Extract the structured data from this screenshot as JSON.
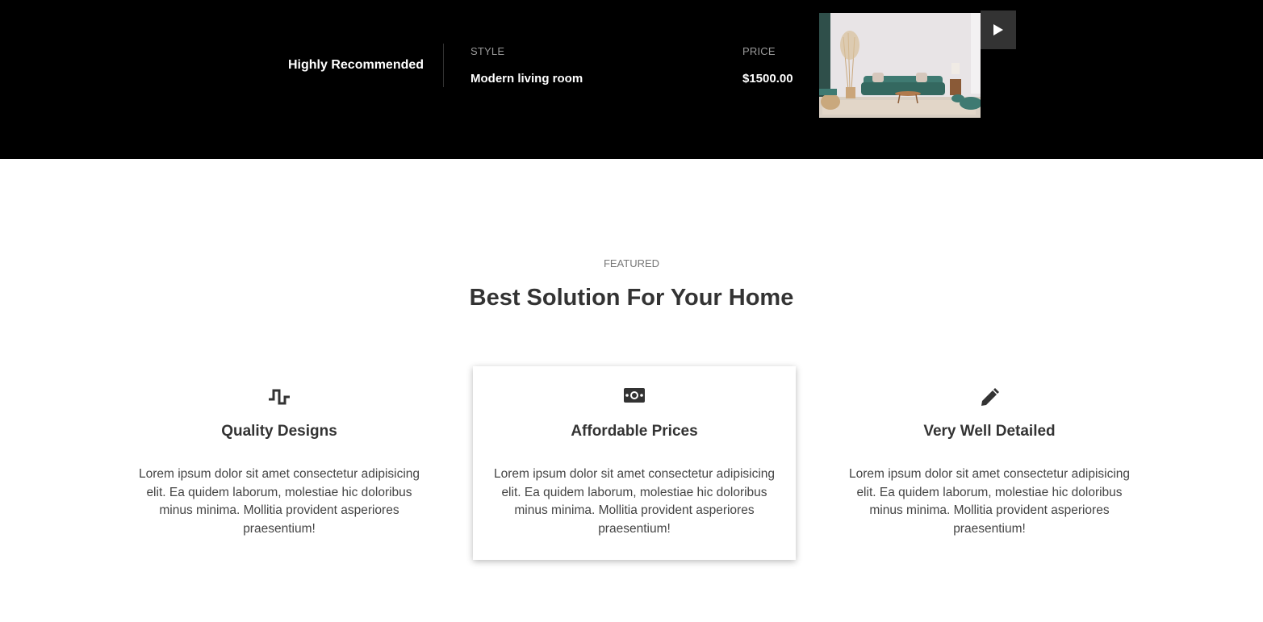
{
  "hero": {
    "recommendation": "Highly Recommended",
    "style_label": "STYLE",
    "style_value": "Modern living room",
    "price_label": "PRICE",
    "price_value": "$1500.00"
  },
  "section": {
    "eyebrow": "FEATURED",
    "title": "Best Solution For Your Home"
  },
  "features": [
    {
      "icon": "pulse-icon",
      "title": "Quality Designs",
      "text": "Lorem ipsum dolor sit amet consectetur adipisicing elit. Ea quidem laborum, molestiae hic doloribus minus minima. Mollitia provident asperiores praesentium!"
    },
    {
      "icon": "money-icon",
      "title": "Affordable Prices",
      "text": "Lorem ipsum dolor sit amet consectetur adipisicing elit. Ea quidem laborum, molestiae hic doloribus minus minima. Mollitia provident asperiores praesentium!"
    },
    {
      "icon": "pencil-icon",
      "title": "Very Well Detailed",
      "text": "Lorem ipsum dolor sit amet consectetur adipisicing elit. Ea quidem laborum, molestiae hic doloribus minus minima. Mollitia provident asperiores praesentium!"
    }
  ],
  "colors": {
    "hero_bg": "#000000",
    "accent_sofa": "#3f7a72",
    "text_dark": "#333333"
  }
}
